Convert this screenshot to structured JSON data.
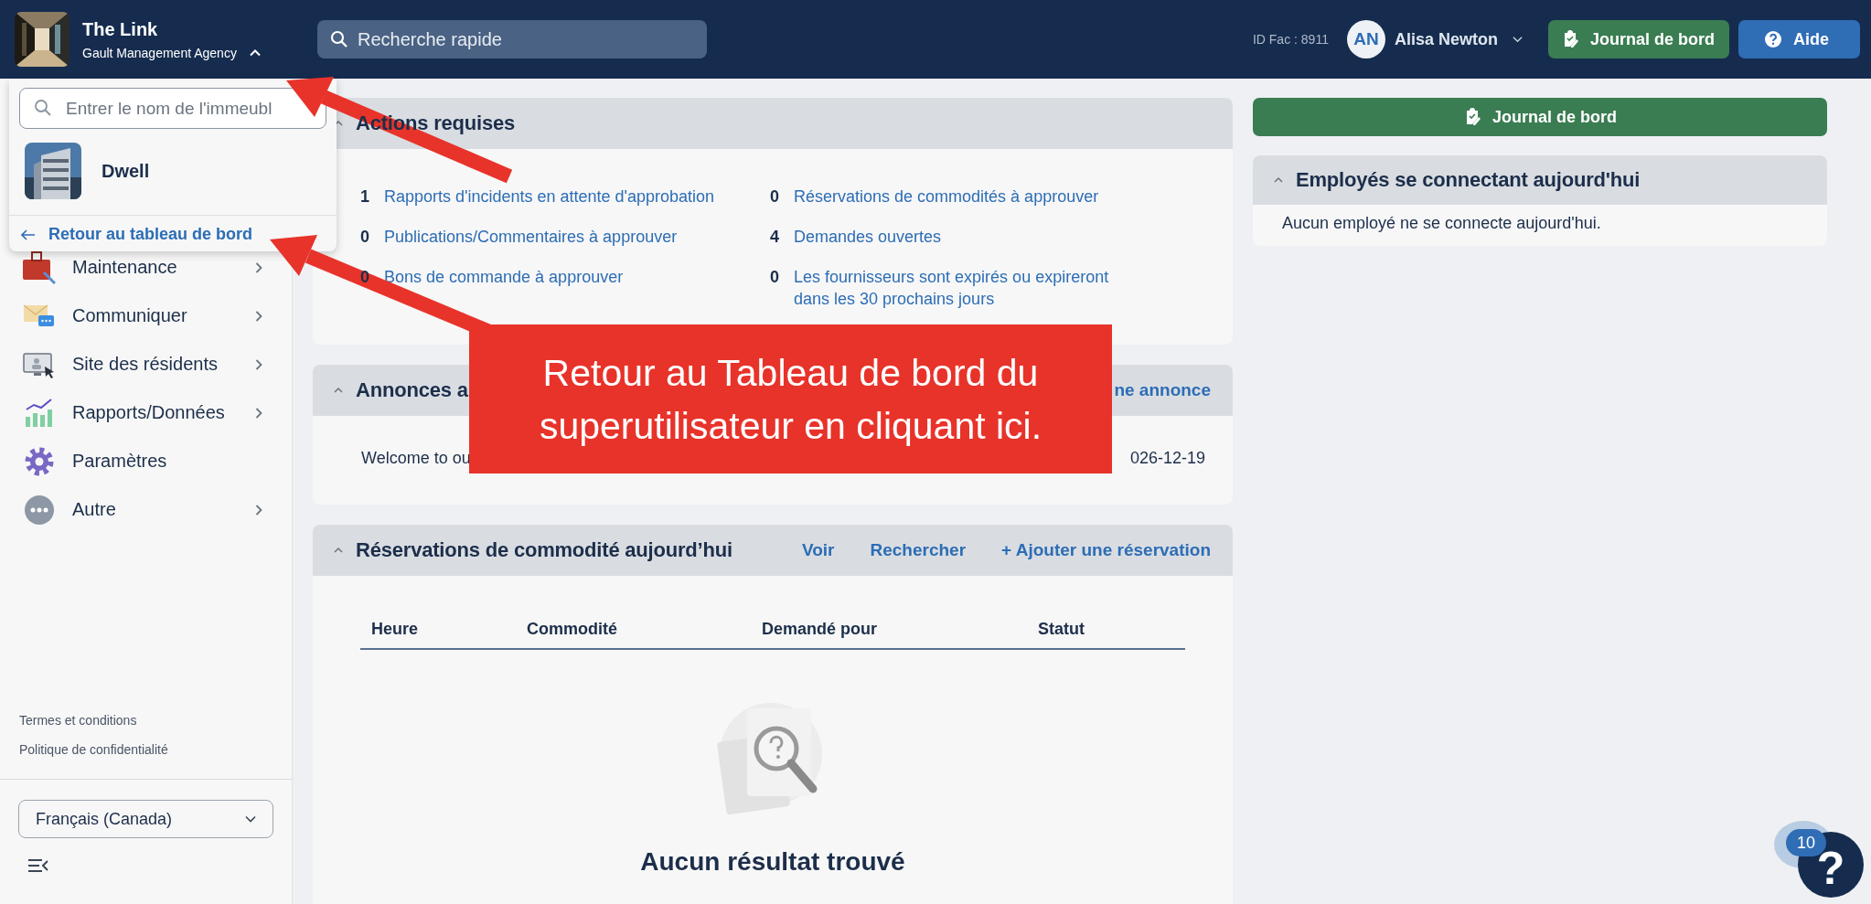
{
  "header": {
    "property_name": "The Link",
    "company": "Gault Management Agency",
    "menu_expanded": true,
    "search": {
      "placeholder": "Recherche rapide"
    },
    "facility_id": "ID Fac : 8911",
    "user": {
      "initials": "AN",
      "name": "Alisa Newton"
    },
    "buttons": [
      {
        "label": "Journal de bord",
        "kind": "journal"
      },
      {
        "label": "Aide",
        "kind": "help"
      }
    ]
  },
  "building_menu": {
    "search": {
      "placeholder": "Entrer le nom de l'immeubl"
    },
    "buildings": [
      {
        "name": "Dwell"
      }
    ],
    "back_link": "Retour au tableau de bord"
  },
  "sidebar": {
    "items": [
      {
        "label": "Maintenance",
        "kind": "maintenance",
        "has_submenu": true
      },
      {
        "label": "Communiquer",
        "kind": "communicate",
        "has_submenu": true
      },
      {
        "label": "Site des résidents",
        "kind": "resident-site",
        "has_submenu": true
      },
      {
        "label": "Rapports/Données",
        "kind": "reports",
        "has_submenu": true
      },
      {
        "label": "Paramètres",
        "kind": "settings",
        "has_submenu": false
      },
      {
        "label": "Autre",
        "kind": "other",
        "has_submenu": true
      }
    ],
    "footer_links": [
      "Termes et conditions",
      "Politique de confidentialité"
    ],
    "language": "Français (Canada)"
  },
  "actions": {
    "title": "Actions requises",
    "columns": [
      [
        {
          "count": "1",
          "label": "Rapports d'incidents en attente d'approbation"
        },
        {
          "count": "0",
          "label": "Publications/Commentaires à approuver"
        },
        {
          "count": "0",
          "label": "Bons de commande à approuver"
        }
      ],
      [
        {
          "count": "0",
          "label": "Réservations de commodités à approuver"
        },
        {
          "count": "4",
          "label": "Demandes ouvertes"
        },
        {
          "count": "0",
          "label": "Les fournisseurs sont expirés ou expireront dans les 30 prochains jours"
        }
      ]
    ]
  },
  "announcements": {
    "title": "Annonces a",
    "link": "ne annonce",
    "rows": [
      {
        "text": "Welcome to ou",
        "date": "026-12-19"
      }
    ]
  },
  "reservations": {
    "title": "Réservations de commodité aujourd’hui",
    "links": [
      "Voir",
      "Rechercher",
      "+ Ajouter une réservation"
    ],
    "columns": [
      "Heure",
      "Commodité",
      "Demandé pour",
      "Statut"
    ],
    "empty": "Aucun résultat trouvé"
  },
  "right_panel": {
    "journal_button": "Journal de bord",
    "employees": {
      "title": "Employés se connectant aujourd'hui",
      "empty": "Aucun employé ne se connecte aujourd'hui."
    }
  },
  "callout": {
    "text": "Retour au Tableau de bord du superutilisateur en cliquant ici."
  },
  "help": {
    "badge": "10",
    "symbol": "?"
  }
}
